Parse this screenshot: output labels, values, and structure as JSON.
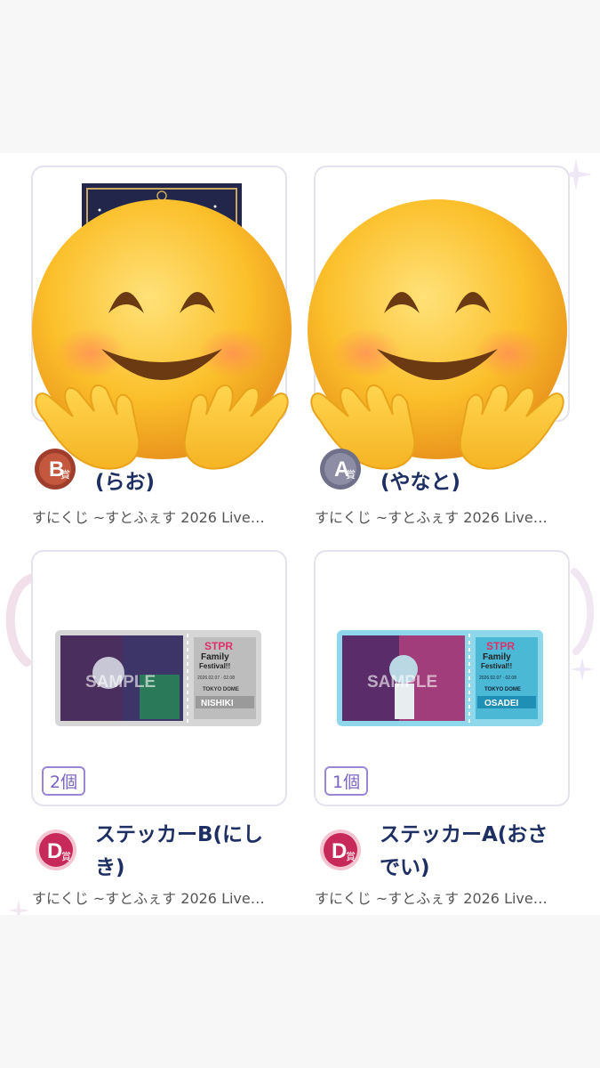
{
  "items": [
    {
      "rank": "B",
      "rank_suffix": "賞",
      "title_visible": "(らお)",
      "subtitle": "すにくじ ~すとふぇす 2026 Live…"
    },
    {
      "rank": "A",
      "rank_suffix": "賞",
      "title_visible": "(やなと)",
      "subtitle": "すにくじ ~すとふぇす 2026 Live…"
    },
    {
      "rank": "D",
      "rank_suffix": "賞",
      "count": "2個",
      "title": "ステッカーB(にし き)",
      "title_line1": "ステッカーB(にし",
      "title_line2": "き)",
      "subtitle": "すにくじ ~すとふぇす 2026 Live…",
      "ticket": {
        "watermark": "SAMPLE",
        "logo_l1": "STPR",
        "logo_l2": "Family",
        "logo_l3": "Festival!!",
        "dates": "2026.02.07 · 02.08",
        "venue": "TOKYO DOME",
        "name": "NISHIKI",
        "color": "#c9c9c9"
      }
    },
    {
      "rank": "D",
      "rank_suffix": "賞",
      "count": "1個",
      "title": "ステッカーA(おさ でい)",
      "title_line1": "ステッカーA(おさ",
      "title_line2": "でい)",
      "subtitle": "すにくじ ~すとふぇす 2026 Live…",
      "ticket": {
        "watermark": "SAMPLE",
        "logo_l1": "STPR",
        "logo_l2": "Family",
        "logo_l3": "Festival!!",
        "dates": "2026.02.07 · 02.08",
        "venue": "TOKYO DOME",
        "name": "OSADEI",
        "color": "#5fc2de"
      }
    }
  ],
  "overlay": {
    "icon": "smiling-face-with-open-hands-emoji"
  },
  "colors": {
    "title": "#1e2f63",
    "badge_border": "#9b86d3",
    "rank_d": "#c7295a",
    "rank_a": "#6e6e86",
    "rank_b": "#8c3528"
  }
}
